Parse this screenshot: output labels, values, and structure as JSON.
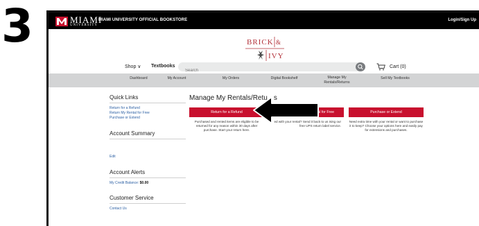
{
  "step_number": "3",
  "topbar": {
    "logo_text": "MIAMI",
    "logo_subtext": "UNIVERSITY",
    "store_name": "MIAMI UNIVERSITY OFFICIAL BOOKSTORE",
    "login_label": "Login/Sign Up"
  },
  "brand": {
    "line1": "BRICK",
    "ampersand": "&",
    "line2": "IVY"
  },
  "nav": {
    "shop_label": "Shop ∨",
    "textbooks_label": "Textbooks",
    "search_placeholder": "Search",
    "cart_label": "Cart (0)"
  },
  "subnav": {
    "items": [
      "Dashboard",
      "My Account",
      "My Orders",
      "Digital Bookshelf",
      "Manage My Rentals/Returns",
      "Sell My Textbooks"
    ]
  },
  "sidebar": {
    "quick_links_heading": "Quick Links",
    "quick_links": [
      "Return for a Refund",
      "Return My Rental for Free",
      "Purchase or Extend"
    ],
    "account_summary_heading": "Account Summary",
    "edit_label": "Edit",
    "alerts_heading": "Account Alerts",
    "credit_label": "My Credit Balance:",
    "credit_value": "$0.00",
    "service_heading": "Customer Service",
    "contact_label": "Contact Us"
  },
  "main": {
    "title": "Manage My Rentals/Retu",
    "title_tail": "s",
    "cards": [
      {
        "button": "Return for a Refund",
        "desc": "Purchased and rented items are eligible to be returned for any reason within 30 days after purchase. Start your return here."
      },
      {
        "button": "ental for Free",
        "desc": "ed with your rental? Send it back to us ising our free UPS return label service."
      },
      {
        "button": "Purchase or Extend",
        "desc": "Need extra time with your rental or want to purchase it to keep? Choose your options here and easily pay for extensions and purchases."
      }
    ]
  },
  "colors": {
    "accent_red": "#c8102e",
    "link_blue": "#2b5fa3",
    "subnav_gray": "#d3d4d5"
  }
}
